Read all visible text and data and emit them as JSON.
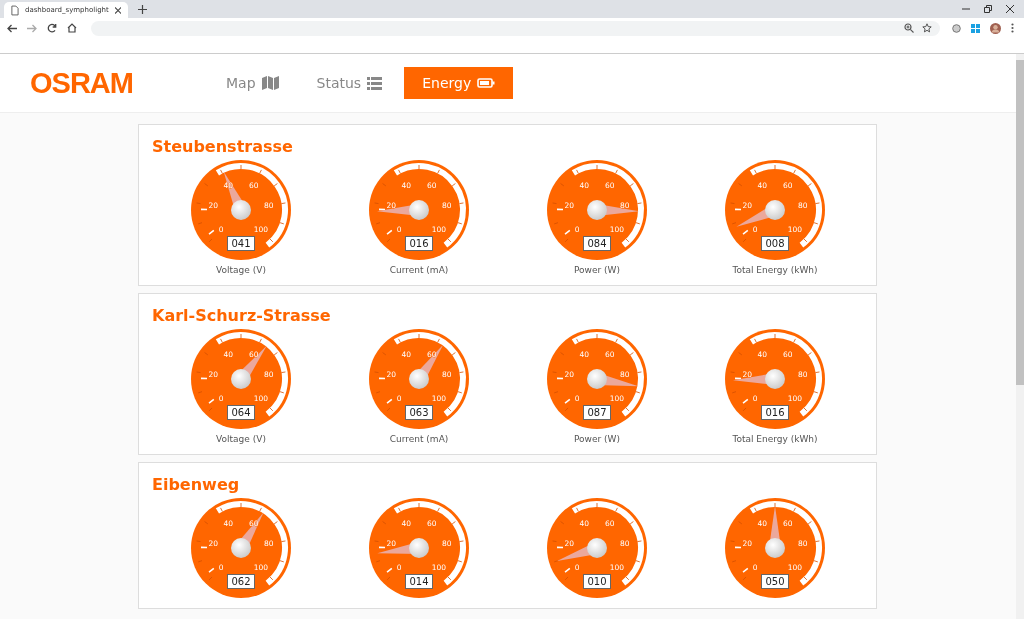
{
  "browser": {
    "tab_title": "dashboard_sympholight"
  },
  "header": {
    "logo": "OSRAM",
    "nav": [
      {
        "label": "Map",
        "selected": false
      },
      {
        "label": "Status",
        "selected": false
      },
      {
        "label": "Energy",
        "selected": true
      }
    ]
  },
  "sections": [
    {
      "title": "Steubenstrasse",
      "gauges": [
        {
          "level": 0.41,
          "reading": "041",
          "label": "Voltage (V)",
          "scale": [
            "0",
            "20",
            "40",
            "60",
            "80",
            "100"
          ]
        },
        {
          "level": 0.16,
          "reading": "016",
          "label": "Current (mA)",
          "scale": [
            "0",
            "20",
            "40",
            "60",
            "80",
            "100"
          ]
        },
        {
          "level": 0.84,
          "reading": "084",
          "label": "Power (W)",
          "scale": [
            "0",
            "20",
            "40",
            "60",
            "80",
            "100"
          ]
        },
        {
          "level": 0.08,
          "reading": "008",
          "label": "Total Energy (kWh)",
          "scale": [
            "0",
            "20",
            "40",
            "60",
            "80",
            "100"
          ]
        }
      ]
    },
    {
      "title": "Karl-Schurz-Strasse",
      "gauges": [
        {
          "level": 0.64,
          "reading": "064",
          "label": "Voltage (V)",
          "scale": [
            "0",
            "20",
            "40",
            "60",
            "80",
            "100"
          ]
        },
        {
          "level": 0.63,
          "reading": "063",
          "label": "Current (mA)",
          "scale": [
            "0",
            "20",
            "40",
            "60",
            "80",
            "100"
          ]
        },
        {
          "level": 0.87,
          "reading": "087",
          "label": "Power (W)",
          "scale": [
            "0",
            "20",
            "40",
            "60",
            "80",
            "100"
          ]
        },
        {
          "level": 0.16,
          "reading": "016",
          "label": "Total Energy (kWh)",
          "scale": [
            "0",
            "20",
            "40",
            "60",
            "80",
            "100"
          ]
        }
      ]
    },
    {
      "title": "Eibenweg",
      "gauges": [
        {
          "level": 0.62,
          "reading": "062",
          "scale": [
            "0",
            "20",
            "40",
            "60",
            "80",
            "100"
          ]
        },
        {
          "level": 0.14,
          "reading": "014",
          "scale": [
            "0",
            "20",
            "40",
            "60",
            "80",
            "100"
          ]
        },
        {
          "level": 0.1,
          "reading": "010",
          "scale": [
            "0",
            "20",
            "40",
            "60",
            "80",
            "100"
          ]
        },
        {
          "level": 0.5,
          "reading": "050",
          "scale": [
            "0",
            "20",
            "40",
            "60",
            "80",
            "100"
          ]
        }
      ]
    }
  ]
}
